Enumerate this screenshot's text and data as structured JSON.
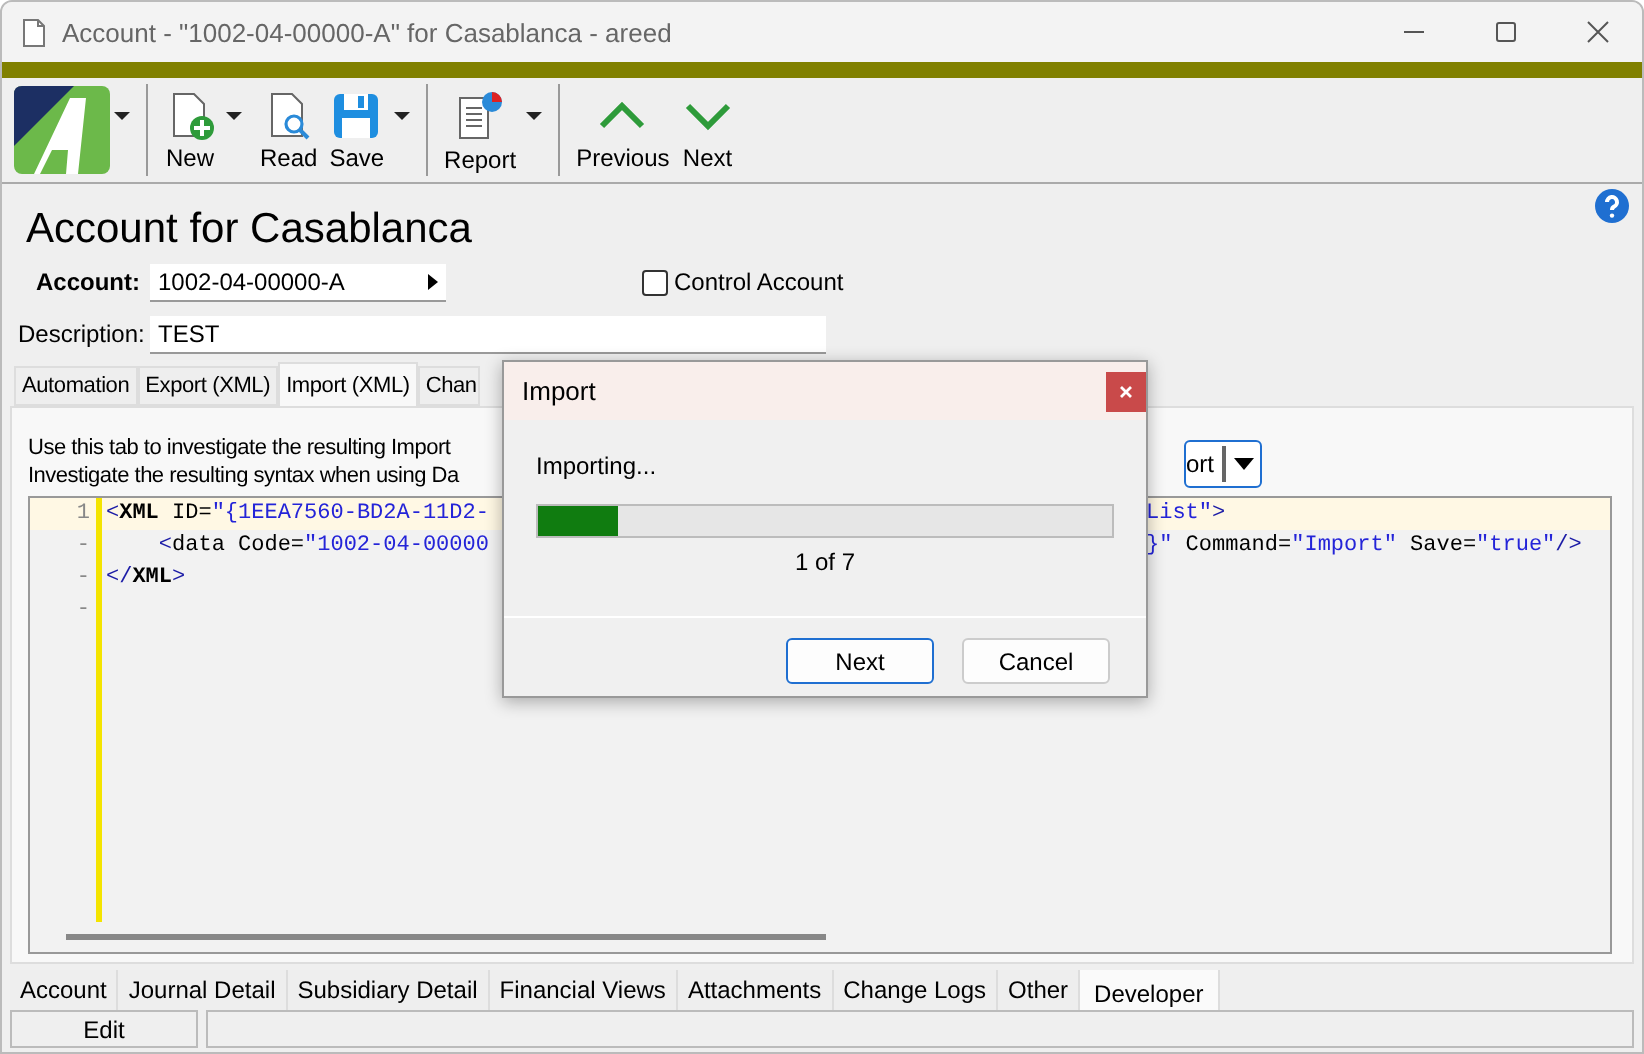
{
  "window": {
    "title": "Account - \"1002-04-00000-A\" for Casablanca - areed"
  },
  "toolbar": [
    {
      "dropdown": true
    },
    {
      "label": "New",
      "dropdown": true
    },
    {
      "label": "Read",
      "dropdown": false
    },
    {
      "label": "Save",
      "dropdown": true
    },
    {
      "label": "Report",
      "dropdown": true
    },
    {
      "label": "Previous",
      "dropdown": false
    },
    {
      "label": "Next",
      "dropdown": false
    }
  ],
  "heading": "Account for Casablanca",
  "account": {
    "label": "Account:",
    "value": "1002-04-00000-A"
  },
  "control_account": {
    "label": "Control Account",
    "checked": false
  },
  "description": {
    "label": "Description:",
    "value": "TEST"
  },
  "tabs": [
    {
      "label": "Automation",
      "selected": false
    },
    {
      "label": "Export (XML)",
      "selected": false
    },
    {
      "label": "Import (XML)",
      "selected": true
    },
    {
      "label": "Chan",
      "selected": false
    }
  ],
  "info_lines": [
    "Use this tab to investigate the resulting Import",
    "Investigate the resulting syntax when using Da"
  ],
  "mode_combo": {
    "value": "ort"
  },
  "code_lines": [
    {
      "number": "1",
      "current": true,
      "left": [
        {
          "text": "<",
          "kind": "punct"
        },
        {
          "text": "XML",
          "kind": "tag"
        },
        {
          "text": " ID=",
          "kind": "attr"
        },
        {
          "text": "\"{1EEA7560-BD2A-11D2-",
          "kind": "value"
        }
      ],
      "right": [
        {
          "text": "List\"",
          "kind": "value"
        },
        {
          "text": ">",
          "kind": "punct"
        }
      ]
    },
    {
      "number": "-",
      "current": false,
      "left": [
        {
          "text": "    <",
          "kind": "punct"
        },
        {
          "text": "data",
          "kind": "attr"
        },
        {
          "text": " Code=",
          "kind": "attr"
        },
        {
          "text": "\"1002-04-00000",
          "kind": "value"
        }
      ],
      "right": [
        {
          "text": "}\"",
          "kind": "value"
        },
        {
          "text": " Command=",
          "kind": "attr"
        },
        {
          "text": "\"Import\"",
          "kind": "value"
        },
        {
          "text": " Save=",
          "kind": "attr"
        },
        {
          "text": "\"true\"",
          "kind": "value"
        },
        {
          "text": "/>",
          "kind": "punct"
        }
      ]
    },
    {
      "number": "-",
      "current": false,
      "left": [
        {
          "text": "</",
          "kind": "punct"
        },
        {
          "text": "XML",
          "kind": "tag"
        },
        {
          "text": ">",
          "kind": "punct"
        }
      ]
    },
    {
      "number": "-",
      "current": false
    }
  ],
  "bottom_tabs": [
    {
      "label": "Account",
      "selected": false
    },
    {
      "label": "Journal Detail",
      "selected": false
    },
    {
      "label": "Subsidiary Detail",
      "selected": false
    },
    {
      "label": "Financial Views",
      "selected": false
    },
    {
      "label": "Attachments",
      "selected": false
    },
    {
      "label": "Change Logs",
      "selected": false
    },
    {
      "label": "Other",
      "selected": false
    },
    {
      "label": "Developer",
      "selected": true
    }
  ],
  "status_bar": {
    "mode": "Edit"
  },
  "dialog": {
    "title": "Import",
    "message": "Importing...",
    "level": 0.14,
    "progress_text": "1 of 7",
    "buttons": [
      {
        "label": "Next",
        "default": true
      },
      {
        "label": "Cancel",
        "default": false
      }
    ]
  }
}
